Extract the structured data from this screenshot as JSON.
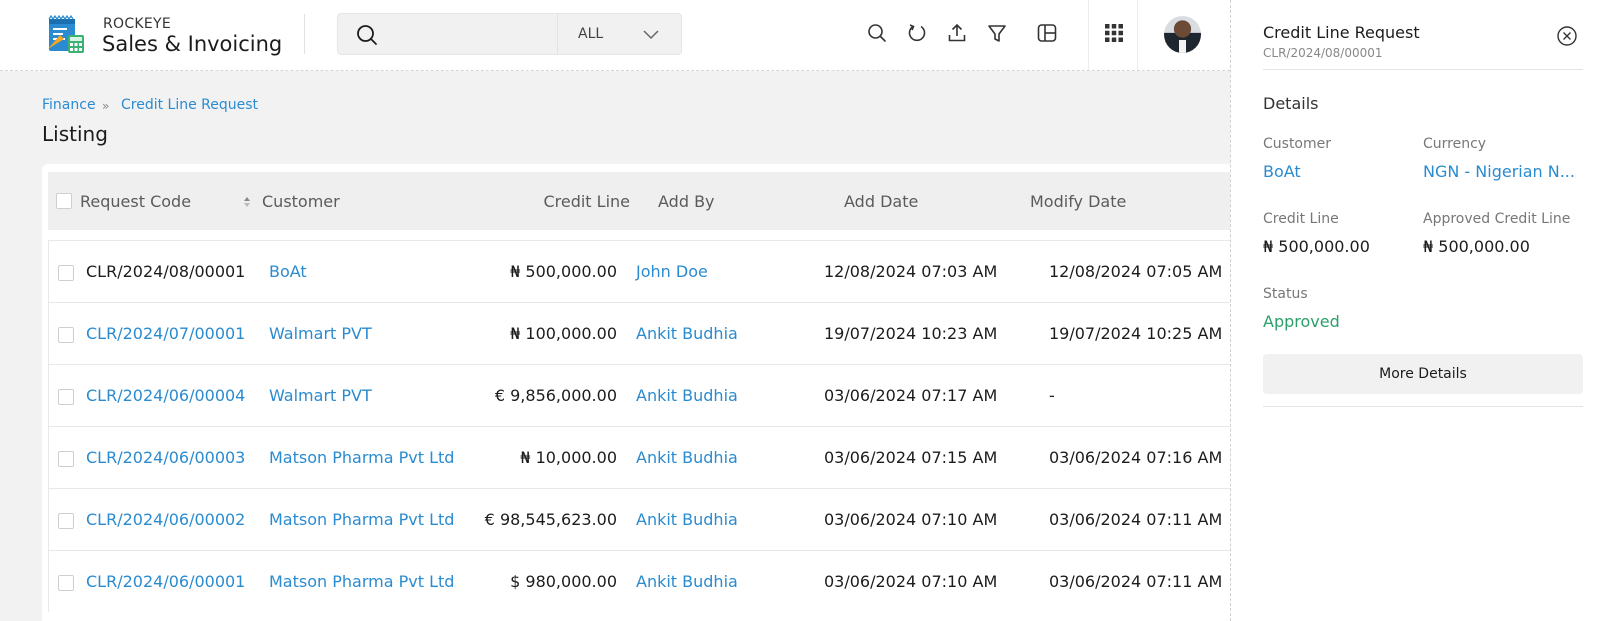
{
  "brand": {
    "top": "ROCKEYE",
    "main": "Sales & Invoicing"
  },
  "search": {
    "value": "",
    "placeholder": "",
    "scope": "ALL"
  },
  "toolbar": {
    "icons": [
      "search-icon",
      "refresh-icon",
      "upload-icon",
      "filter-icon",
      "columns-icon",
      "apps-grid-icon"
    ]
  },
  "breadcrumb": {
    "items": [
      "Finance",
      "Credit Line Request"
    ]
  },
  "page": {
    "title": "Listing"
  },
  "table": {
    "columns": [
      "Request Code",
      "Customer",
      "Credit Line",
      "Add By",
      "Add Date",
      "Modify Date"
    ],
    "rows": [
      {
        "code": "CLR/2024/08/00001",
        "customer": "BoAt",
        "credit": "₦ 500,000.00",
        "add_by": "John Doe",
        "add_date": "12/08/2024 07:03 AM",
        "modify_date": "12/08/2024 07:05 AM"
      },
      {
        "code": "CLR/2024/07/00001",
        "customer": "Walmart PVT",
        "credit": "₦ 100,000.00",
        "add_by": "Ankit Budhia",
        "add_date": "19/07/2024 10:23 AM",
        "modify_date": "19/07/2024 10:25 AM"
      },
      {
        "code": "CLR/2024/06/00004",
        "customer": "Walmart PVT",
        "credit": "€ 9,856,000.00",
        "add_by": "Ankit Budhia",
        "add_date": "03/06/2024 07:17 AM",
        "modify_date": "-"
      },
      {
        "code": "CLR/2024/06/00003",
        "customer": "Matson Pharma Pvt Ltd",
        "credit": "₦ 10,000.00",
        "add_by": "Ankit Budhia",
        "add_date": "03/06/2024 07:15 AM",
        "modify_date": "03/06/2024 07:16 AM"
      },
      {
        "code": "CLR/2024/06/00002",
        "customer": "Matson Pharma Pvt Ltd",
        "credit": "€ 98,545,623.00",
        "add_by": "Ankit Budhia",
        "add_date": "03/06/2024 07:10 AM",
        "modify_date": "03/06/2024 07:11 AM"
      },
      {
        "code": "CLR/2024/06/00001",
        "customer": "Matson Pharma Pvt Ltd",
        "credit": "$ 980,000.00",
        "add_by": "Ankit Budhia",
        "add_date": "03/06/2024 07:10 AM",
        "modify_date": "03/06/2024 07:11 AM"
      }
    ]
  },
  "panel": {
    "title": "Credit Line Request",
    "code": "CLR/2024/08/00001",
    "section": "Details",
    "customer_label": "Customer",
    "customer_value": "BoAt",
    "currency_label": "Currency",
    "currency_value": "NGN - Nigerian N...",
    "credit_label": "Credit Line",
    "credit_value": "₦ 500,000.00",
    "approved_label": "Approved Credit Line",
    "approved_value": "₦ 500,000.00",
    "status_label": "Status",
    "status_value": "Approved",
    "more_button": "More Details"
  },
  "colors": {
    "link": "#2a8bd0",
    "status_approved": "#2aa06a",
    "header_bg": "#efefef"
  }
}
